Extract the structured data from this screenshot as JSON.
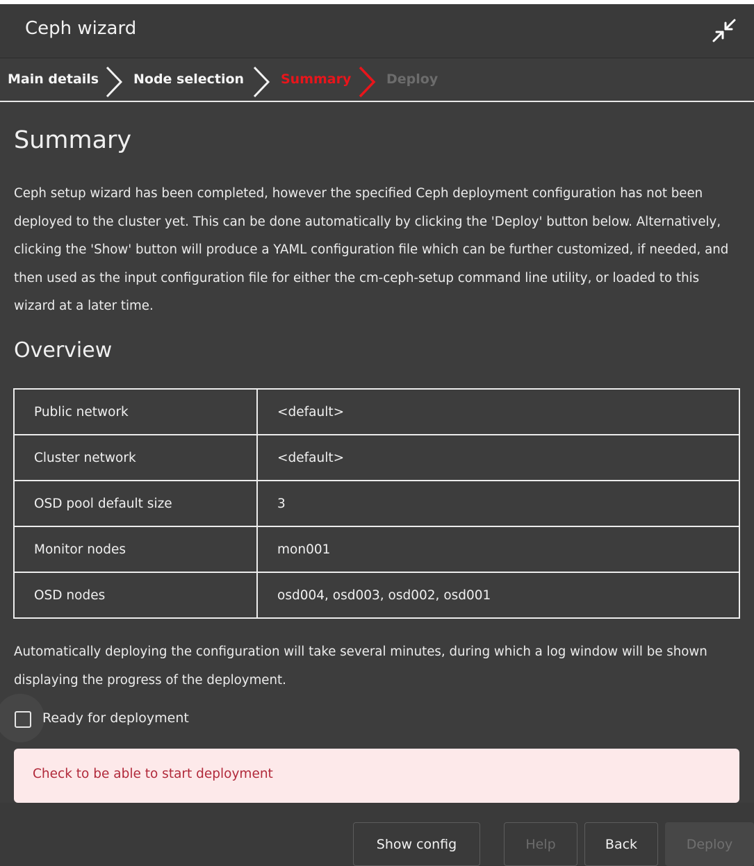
{
  "window": {
    "title": "Ceph wizard"
  },
  "steps": [
    {
      "label": "Main details",
      "state": "done"
    },
    {
      "label": "Node selection",
      "state": "done"
    },
    {
      "label": "Summary",
      "state": "active"
    },
    {
      "label": "Deploy",
      "state": "disabled"
    }
  ],
  "summary": {
    "heading": "Summary",
    "description": "Ceph setup wizard has been completed, however the specified Ceph deployment configuration has not been deployed to the cluster yet. This can be done automatically by clicking the 'Deploy' button below. Alternatively, clicking the 'Show' button will produce a YAML configuration file which can be further customized, if needed, and then used as the input configuration file for either the cm-ceph-setup command line utility, or loaded to this wizard at a later time."
  },
  "overview": {
    "heading": "Overview",
    "rows": [
      {
        "key": "Public network",
        "value": "<default>"
      },
      {
        "key": "Cluster network",
        "value": "<default>"
      },
      {
        "key": "OSD pool default size",
        "value": "3"
      },
      {
        "key": "Monitor nodes",
        "value": "mon001"
      },
      {
        "key": "OSD nodes",
        "value": "osd004, osd003, osd002, osd001"
      }
    ]
  },
  "deploy_note": "Automatically deploying the configuration will take several minutes, during which a log window will be shown displaying the progress of the deployment.",
  "ready_checkbox": {
    "label": "Ready for deployment",
    "checked": false
  },
  "alert": {
    "text": "Check to be able to start deployment"
  },
  "footer": {
    "show_config": "Show config",
    "help": "Help",
    "back": "Back",
    "deploy": "Deploy"
  },
  "colors": {
    "background": "#3d3d3d",
    "active_step": "#e8151b",
    "alert_bg": "#fde9ea",
    "alert_text": "#b1293a"
  },
  "icons": {
    "collapse": "collapse-arrows-icon",
    "step_separator": "chevron-right-icon"
  }
}
